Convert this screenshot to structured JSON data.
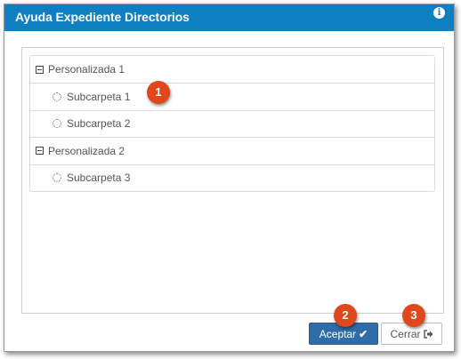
{
  "dialog": {
    "title": "Ayuda Expediente Directorios",
    "info_icon": "i"
  },
  "tree": {
    "items": [
      {
        "label": "Personalizada 1",
        "type": "parent",
        "icon": "collapse-icon"
      },
      {
        "label": "Subcarpeta 1",
        "type": "child",
        "icon": "folder-icon"
      },
      {
        "label": "Subcarpeta 2",
        "type": "child",
        "icon": "folder-icon"
      },
      {
        "label": "Personalizada 2",
        "type": "parent",
        "icon": "collapse-icon"
      },
      {
        "label": "Subcarpeta 3",
        "type": "child",
        "icon": "folder-icon"
      }
    ]
  },
  "buttons": {
    "accept_label": "Aceptar",
    "close_label": "Cerrar"
  },
  "badges": [
    "1",
    "2",
    "3"
  ],
  "colors": {
    "titlebar": "#0e7fc0",
    "accept_button": "#2f6da8",
    "badge": "#e0471c"
  }
}
